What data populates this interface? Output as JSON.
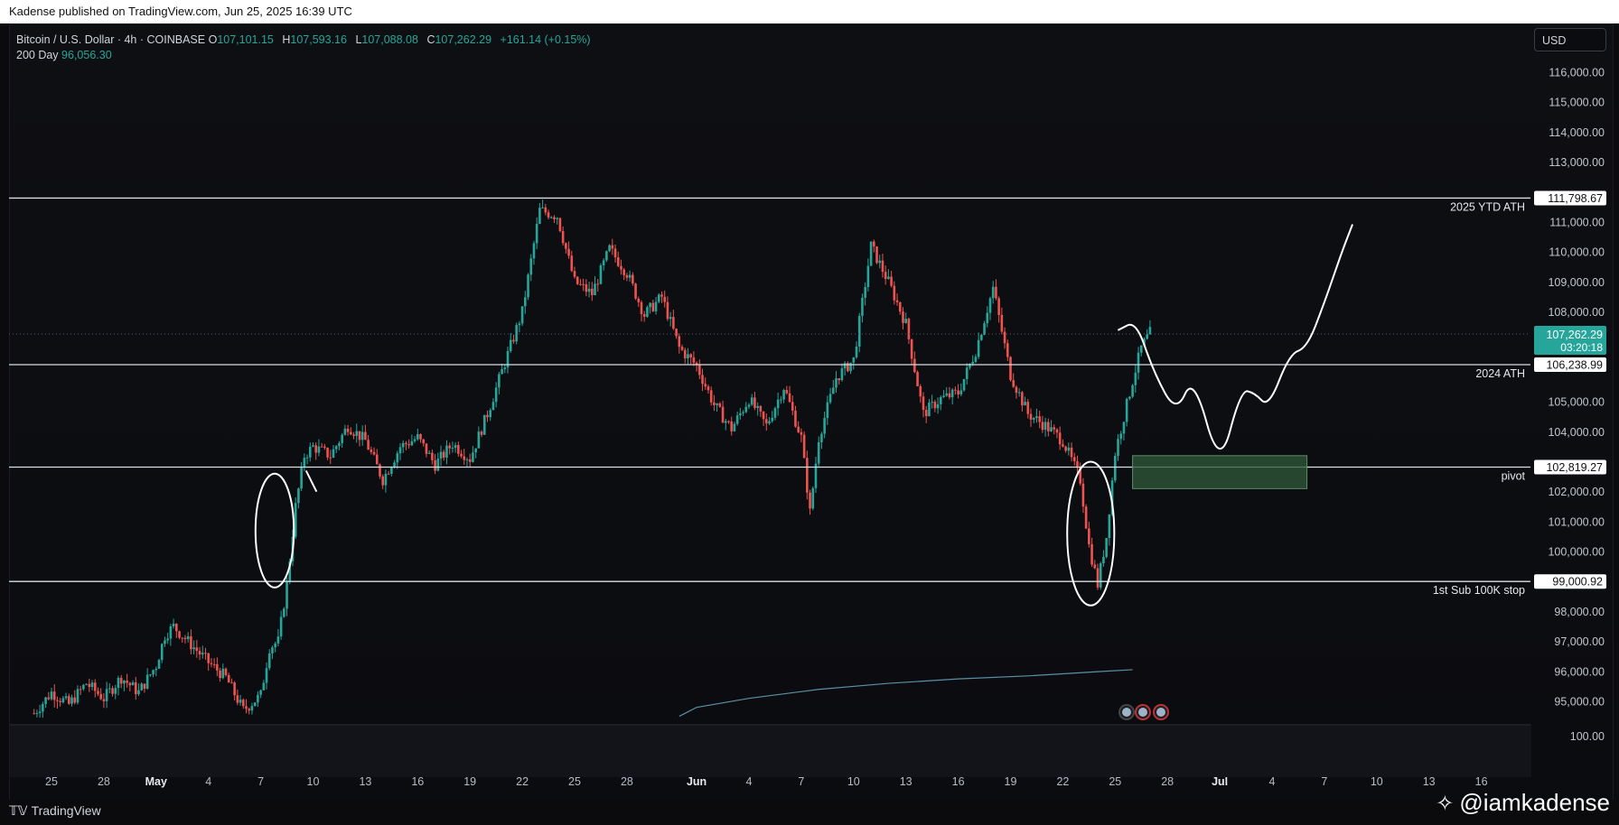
{
  "header": {
    "published": "Kadense published on TradingView.com, Jun 25, 2025 16:39 UTC"
  },
  "legend": {
    "symbol": "Bitcoin / U.S. Dollar · 4h · COINBASE",
    "o_label": "O",
    "o": "107,101.15",
    "h_label": "H",
    "h": "107,593.16",
    "l_label": "L",
    "l": "107,088.08",
    "c_label": "C",
    "c": "107,262.29",
    "change": "+161.14 (+0.15%)",
    "ma_label": "200 Day",
    "ma_value": "96,056.30"
  },
  "currency_button": "USD",
  "footer": {
    "logo_mark": "𝕋𝕍",
    "logo_text": "TradingView",
    "watermark_icon": "binance-diamond-icon",
    "watermark": "@iamkadense"
  },
  "colors": {
    "up": "#26a69a",
    "down": "#ef5350",
    "price_label": "#26a69a",
    "zone": "#2f5a3b"
  },
  "chart_data": {
    "type": "candlestick",
    "y_ticks": [
      "116,000.00",
      "115,000.00",
      "114,000.00",
      "113,000.00",
      "111,000.00",
      "110,000.00",
      "109,000.00",
      "108,000.00",
      "105,000.00",
      "104,000.00",
      "102,000.00",
      "101,000.00",
      "100,000.00",
      "98,000.00",
      "97,000.00",
      "96,000.00",
      "95,000.00"
    ],
    "volume_tick": "100.00",
    "ylim": [
      94500,
      117000
    ],
    "x_ticks": [
      {
        "label": "25",
        "day": 0
      },
      {
        "label": "28",
        "day": 3
      },
      {
        "label": "May",
        "day": 6
      },
      {
        "label": "4",
        "day": 9
      },
      {
        "label": "7",
        "day": 12
      },
      {
        "label": "10",
        "day": 15
      },
      {
        "label": "13",
        "day": 18
      },
      {
        "label": "16",
        "day": 21
      },
      {
        "label": "19",
        "day": 24
      },
      {
        "label": "22",
        "day": 27
      },
      {
        "label": "25",
        "day": 30
      },
      {
        "label": "28",
        "day": 33
      },
      {
        "label": "Jun",
        "day": 37
      },
      {
        "label": "4",
        "day": 40
      },
      {
        "label": "7",
        "day": 43
      },
      {
        "label": "10",
        "day": 46
      },
      {
        "label": "13",
        "day": 49
      },
      {
        "label": "16",
        "day": 52
      },
      {
        "label": "19",
        "day": 55
      },
      {
        "label": "22",
        "day": 58
      },
      {
        "label": "25",
        "day": 61
      },
      {
        "label": "28",
        "day": 64
      },
      {
        "label": "Jul",
        "day": 67
      },
      {
        "label": "4",
        "day": 70
      },
      {
        "label": "7",
        "day": 73
      },
      {
        "label": "10",
        "day": 76
      },
      {
        "label": "13",
        "day": 79
      },
      {
        "label": "16",
        "day": 82
      }
    ],
    "horizontal_levels": [
      {
        "price": 111798.67,
        "label": "111,798.67",
        "name": "2025 YTD ATH"
      },
      {
        "price": 106238.99,
        "label": "106,238.99",
        "name": "2024 ATH"
      },
      {
        "price": 102819.27,
        "label": "102,819.27",
        "name": "pivot"
      },
      {
        "price": 99000.92,
        "label": "99,000.92",
        "name": "1st Sub 100K stop"
      }
    ],
    "last_price": {
      "price": 107262.29,
      "label": "107,262.29",
      "countdown": "03:20:18"
    },
    "zone": {
      "from_day": 62,
      "to_day": 72,
      "low": 102100,
      "high": 103200
    },
    "ma_200": {
      "points": [
        [
          36,
          94500
        ],
        [
          37,
          94800
        ],
        [
          40,
          95100
        ],
        [
          44,
          95400
        ],
        [
          48,
          95600
        ],
        [
          52,
          95750
        ],
        [
          56,
          95850
        ],
        [
          58,
          95920
        ],
        [
          60,
          95990
        ],
        [
          62,
          96056
        ]
      ]
    },
    "price_path": [
      [
        -1,
        94600
      ],
      [
        0,
        95300
      ],
      [
        1,
        94900
      ],
      [
        2,
        95600
      ],
      [
        3,
        95100
      ],
      [
        4,
        95800
      ],
      [
        5,
        95300
      ],
      [
        6,
        96200
      ],
      [
        6.5,
        97200
      ],
      [
        7,
        97500
      ],
      [
        8,
        96900
      ],
      [
        9,
        96300
      ],
      [
        10,
        95800
      ],
      [
        11,
        94700
      ],
      [
        12,
        95200
      ],
      [
        12.5,
        96800
      ],
      [
        13,
        97000
      ],
      [
        13.5,
        98900
      ],
      [
        14,
        101500
      ],
      [
        14.5,
        103200
      ],
      [
        15,
        103500
      ],
      [
        16,
        103200
      ],
      [
        17,
        104200
      ],
      [
        18,
        103700
      ],
      [
        19,
        102400
      ],
      [
        20,
        103500
      ],
      [
        21,
        103800
      ],
      [
        22,
        102900
      ],
      [
        23,
        103600
      ],
      [
        24,
        103100
      ],
      [
        25,
        104600
      ],
      [
        26,
        106300
      ],
      [
        27,
        108000
      ],
      [
        28,
        111400
      ],
      [
        29,
        111200
      ],
      [
        30,
        109000
      ],
      [
        31,
        108600
      ],
      [
        32,
        110100
      ],
      [
        33,
        109300
      ],
      [
        34,
        107900
      ],
      [
        35,
        108500
      ],
      [
        36,
        106800
      ],
      [
        37,
        106200
      ],
      [
        38,
        104900
      ],
      [
        39,
        104100
      ],
      [
        40,
        105100
      ],
      [
        41,
        104200
      ],
      [
        42,
        105500
      ],
      [
        43,
        103800
      ],
      [
        43.5,
        101300
      ],
      [
        44,
        103800
      ],
      [
        45,
        105800
      ],
      [
        46,
        106400
      ],
      [
        47,
        110200
      ],
      [
        48,
        109000
      ],
      [
        49,
        107600
      ],
      [
        50,
        104600
      ],
      [
        51,
        105100
      ],
      [
        52,
        105300
      ],
      [
        53,
        106700
      ],
      [
        54,
        108800
      ],
      [
        55,
        105900
      ],
      [
        56,
        104600
      ],
      [
        57,
        104200
      ],
      [
        58,
        103700
      ],
      [
        59,
        102400
      ],
      [
        59.5,
        100200
      ],
      [
        60,
        98900
      ],
      [
        60.5,
        100500
      ],
      [
        61,
        103300
      ],
      [
        62,
        105700
      ],
      [
        62.5,
        106800
      ],
      [
        63,
        107300
      ]
    ],
    "drawn_projection": [
      [
        61.2,
        107400
      ],
      [
        62.2,
        107700
      ],
      [
        63.2,
        106000
      ],
      [
        64.5,
        104600
      ],
      [
        65.5,
        105900
      ],
      [
        67,
        102700
      ],
      [
        68.2,
        105400
      ],
      [
        69,
        105300
      ],
      [
        69.8,
        104800
      ],
      [
        71,
        106600
      ],
      [
        72,
        106800
      ],
      [
        73,
        108300
      ],
      [
        74,
        110000
      ],
      [
        74.6,
        110900
      ]
    ],
    "circle_annotations": [
      {
        "center_day": 12.8,
        "center_price": 100700,
        "rx_days": 1.1,
        "ry_price": 1900
      },
      {
        "center_day": 59.6,
        "center_price": 100600,
        "rx_days": 1.35,
        "ry_price": 2400
      }
    ]
  }
}
